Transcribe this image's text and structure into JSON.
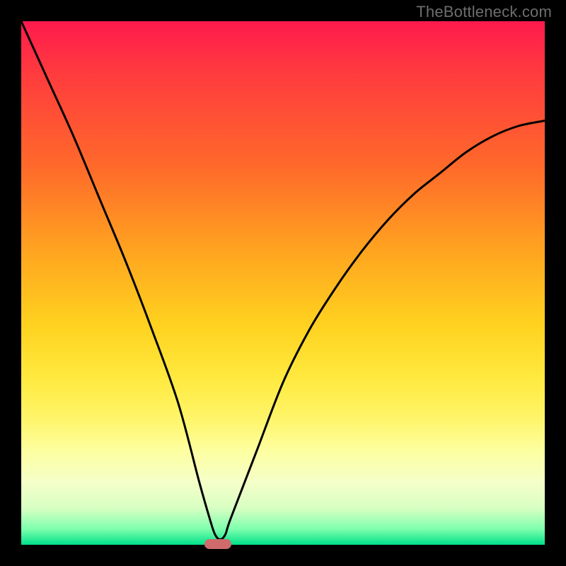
{
  "watermark": "TheBottleneck.com",
  "colors": {
    "frame": "#000000",
    "curve": "#000000",
    "marker": "#cf6b6b",
    "gradient_top": "#ff1a4d",
    "gradient_bottom": "#00e08a"
  },
  "chart_data": {
    "type": "line",
    "title": "",
    "xlabel": "",
    "ylabel": "",
    "xlim": [
      0,
      100
    ],
    "ylim": [
      0,
      100
    ],
    "grid": false,
    "legend": false,
    "series": [
      {
        "name": "bottleneck-curve",
        "x": [
          0,
          5,
          10,
          15,
          20,
          25,
          30,
          34,
          36,
          37,
          38,
          39,
          40,
          45,
          50,
          55,
          60,
          65,
          70,
          75,
          80,
          85,
          90,
          95,
          100
        ],
        "y": [
          100,
          89,
          78,
          66,
          54,
          41,
          27,
          12,
          5,
          2,
          1,
          2,
          5,
          18,
          31,
          41,
          49,
          56,
          62,
          67,
          71,
          75,
          78,
          80,
          81
        ]
      }
    ],
    "annotations": [
      {
        "name": "optimal-marker",
        "x": 37.5,
        "y": 0,
        "shape": "rounded-rect"
      }
    ]
  }
}
